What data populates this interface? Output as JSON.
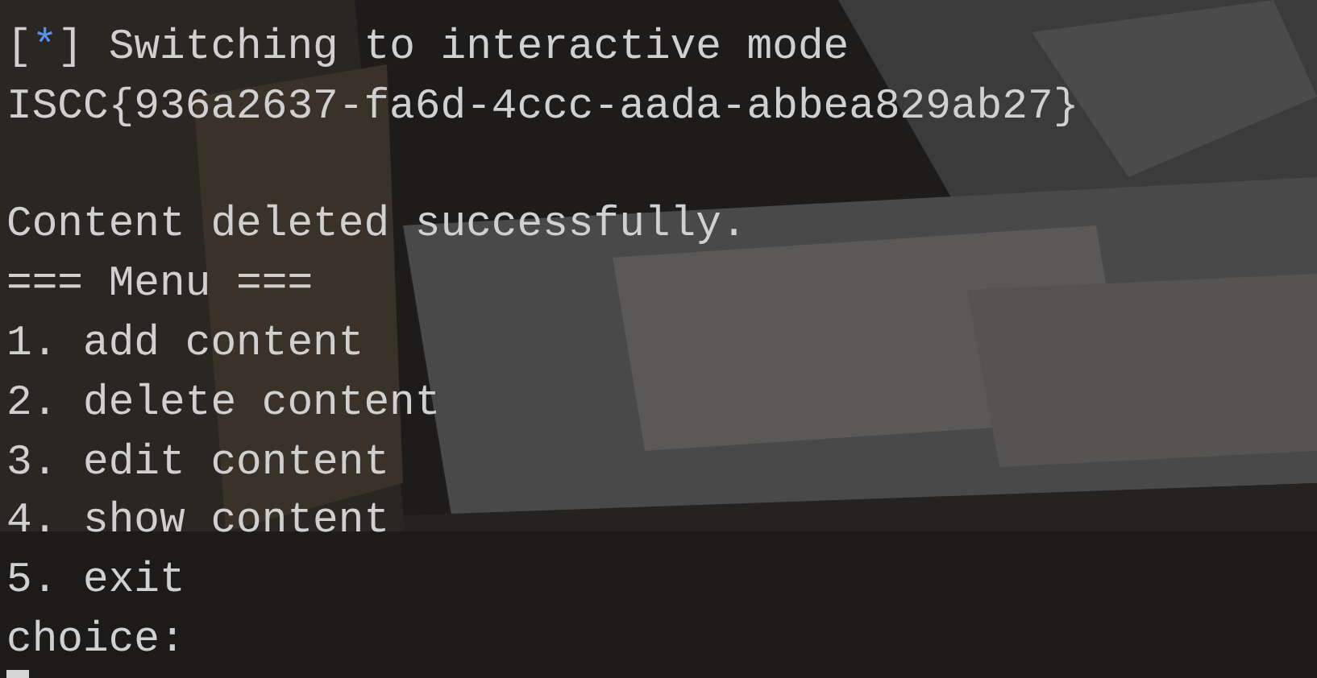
{
  "terminal": {
    "blocks": [
      {
        "lines": [
          {
            "segments": [
              {
                "kind": "plain",
                "text": "["
              },
              {
                "kind": "accent",
                "text": "*"
              },
              {
                "kind": "plain",
                "text": "] Switching to interactive mode"
              }
            ]
          },
          {
            "segments": [
              {
                "kind": "plain",
                "text": "ISCC{936a2637-fa6d-4ccc-aada-abbea829ab27}"
              }
            ]
          }
        ]
      },
      {
        "lines": [
          {
            "segments": [
              {
                "kind": "plain",
                "text": "Content deleted successfully."
              }
            ]
          },
          {
            "segments": [
              {
                "kind": "plain",
                "text": "=== Menu ==="
              }
            ]
          },
          {
            "segments": [
              {
                "kind": "plain",
                "text": "1. add content"
              }
            ]
          },
          {
            "segments": [
              {
                "kind": "plain",
                "text": "2. delete content"
              }
            ]
          },
          {
            "segments": [
              {
                "kind": "plain",
                "text": "3. edit content"
              }
            ]
          },
          {
            "segments": [
              {
                "kind": "plain",
                "text": "4. show content"
              }
            ]
          },
          {
            "segments": [
              {
                "kind": "plain",
                "text": "5. exit"
              }
            ]
          },
          {
            "segments": [
              {
                "kind": "plain",
                "text": "choice:"
              }
            ]
          }
        ]
      }
    ]
  }
}
